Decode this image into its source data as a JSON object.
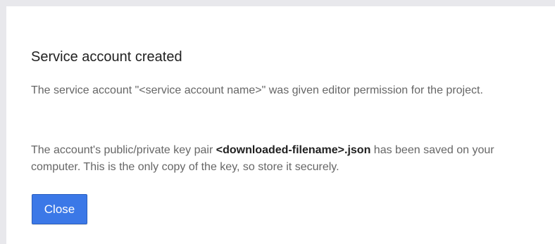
{
  "dialog": {
    "title": "Service account created",
    "paragraph1": "The service account \"<service account name>\" was given editor permission for the project.",
    "paragraph2": {
      "before": "The account's public/private key pair ",
      "filename": "<downloaded-filename>.json",
      "after": " has been saved on your computer. This is the only copy of the key, so store it securely."
    },
    "close_label": "Close"
  },
  "colors": {
    "background": "#e8e8ec",
    "dialog": "#ffffff",
    "title_text": "#212121",
    "body_text": "#666666",
    "button": "#3b78e7",
    "button_text": "#ffffff"
  }
}
